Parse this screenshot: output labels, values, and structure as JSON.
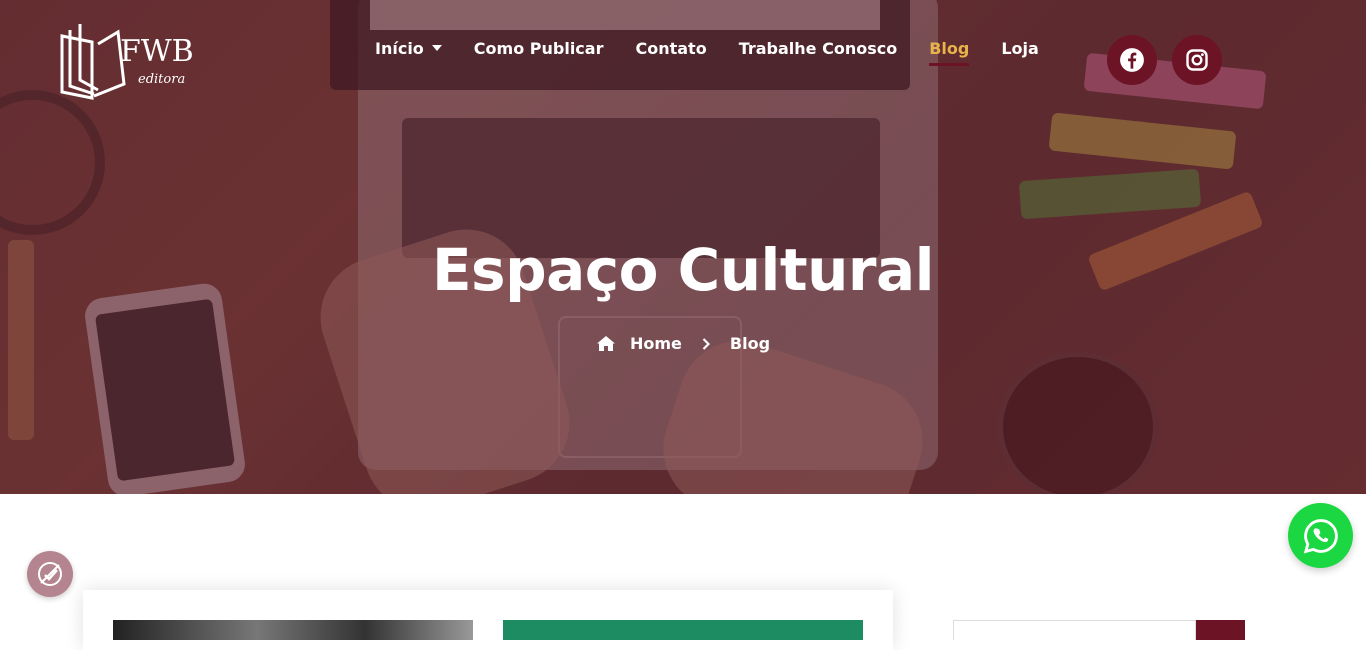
{
  "header": {
    "logo_text": "FWB",
    "logo_subtext": "editora",
    "nav": [
      {
        "label": "Início",
        "has_dropdown": true,
        "active": false
      },
      {
        "label": "Como Publicar",
        "has_dropdown": false,
        "active": false
      },
      {
        "label": "Contato",
        "has_dropdown": false,
        "active": false
      },
      {
        "label": "Trabalhe Conosco",
        "has_dropdown": false,
        "active": false
      },
      {
        "label": "Blog",
        "has_dropdown": false,
        "active": true
      },
      {
        "label": "Loja",
        "has_dropdown": false,
        "active": false
      }
    ],
    "social": [
      {
        "icon": "facebook-icon"
      },
      {
        "icon": "instagram-icon"
      }
    ]
  },
  "hero": {
    "title": "Espaço Cultural",
    "breadcrumb": {
      "home_label": "Home",
      "current_label": "Blog"
    }
  },
  "colors": {
    "brand": "#6d1326",
    "nav_active": "#e8b34a",
    "whatsapp": "#1bd741",
    "accessibility": "#b48491"
  },
  "floating": {
    "accessibility_icon": "accessibility-icon",
    "whatsapp_icon": "whatsapp-icon"
  }
}
